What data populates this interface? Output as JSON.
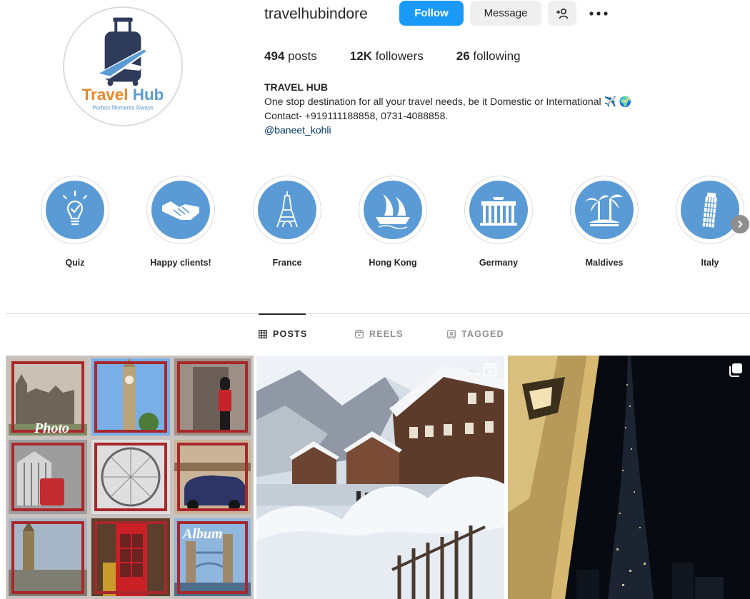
{
  "profile": {
    "username": "travelhubindore",
    "logo_text": "Travel Hub",
    "logo_tagline": "Perfect Moments Always",
    "buttons": {
      "follow": "Follow",
      "message": "Message"
    },
    "stats": [
      {
        "value": "494",
        "label": " posts"
      },
      {
        "value": "12K",
        "label": " followers"
      },
      {
        "value": "26",
        "label": " following"
      }
    ],
    "bio": {
      "name": "TRAVEL HUB",
      "line1": "One stop destination for all your travel needs, be it Domestic or International",
      "line1_emoji": "✈️ 🌍",
      "line2": "Contact- +919111188858, 0731-4088858.",
      "mention": "@baneet_kohli"
    }
  },
  "highlights": [
    {
      "label": "Quiz",
      "icon": "lightbulb-icon"
    },
    {
      "label": "Happy clients!",
      "icon": "handshake-icon"
    },
    {
      "label": "France",
      "icon": "eiffel-tower-icon"
    },
    {
      "label": "Hong Kong",
      "icon": "junk-boat-icon"
    },
    {
      "label": "Germany",
      "icon": "brandenburg-gate-icon"
    },
    {
      "label": "Maldives",
      "icon": "palm-island-icon"
    },
    {
      "label": "Italy",
      "icon": "leaning-tower-icon"
    }
  ],
  "tabs": [
    {
      "label": "POSTS",
      "icon": "grid-icon",
      "active": true
    },
    {
      "label": "REELS",
      "icon": "reels-icon",
      "active": false
    },
    {
      "label": "TAGGED",
      "icon": "tagged-icon",
      "active": false
    }
  ],
  "posts": [
    {
      "overlay_top": "Photo",
      "overlay_bottom": "Album",
      "badge": "none"
    },
    {
      "badge": "reel-icon"
    },
    {
      "badge": "carousel-icon"
    }
  ],
  "colors": {
    "follow_blue": "#1a9af7",
    "highlight_blue": "#5b9bd5",
    "logo_orange": "#e8872a",
    "logo_navy": "#2e3b5b",
    "collage_red": "#a8272b"
  }
}
